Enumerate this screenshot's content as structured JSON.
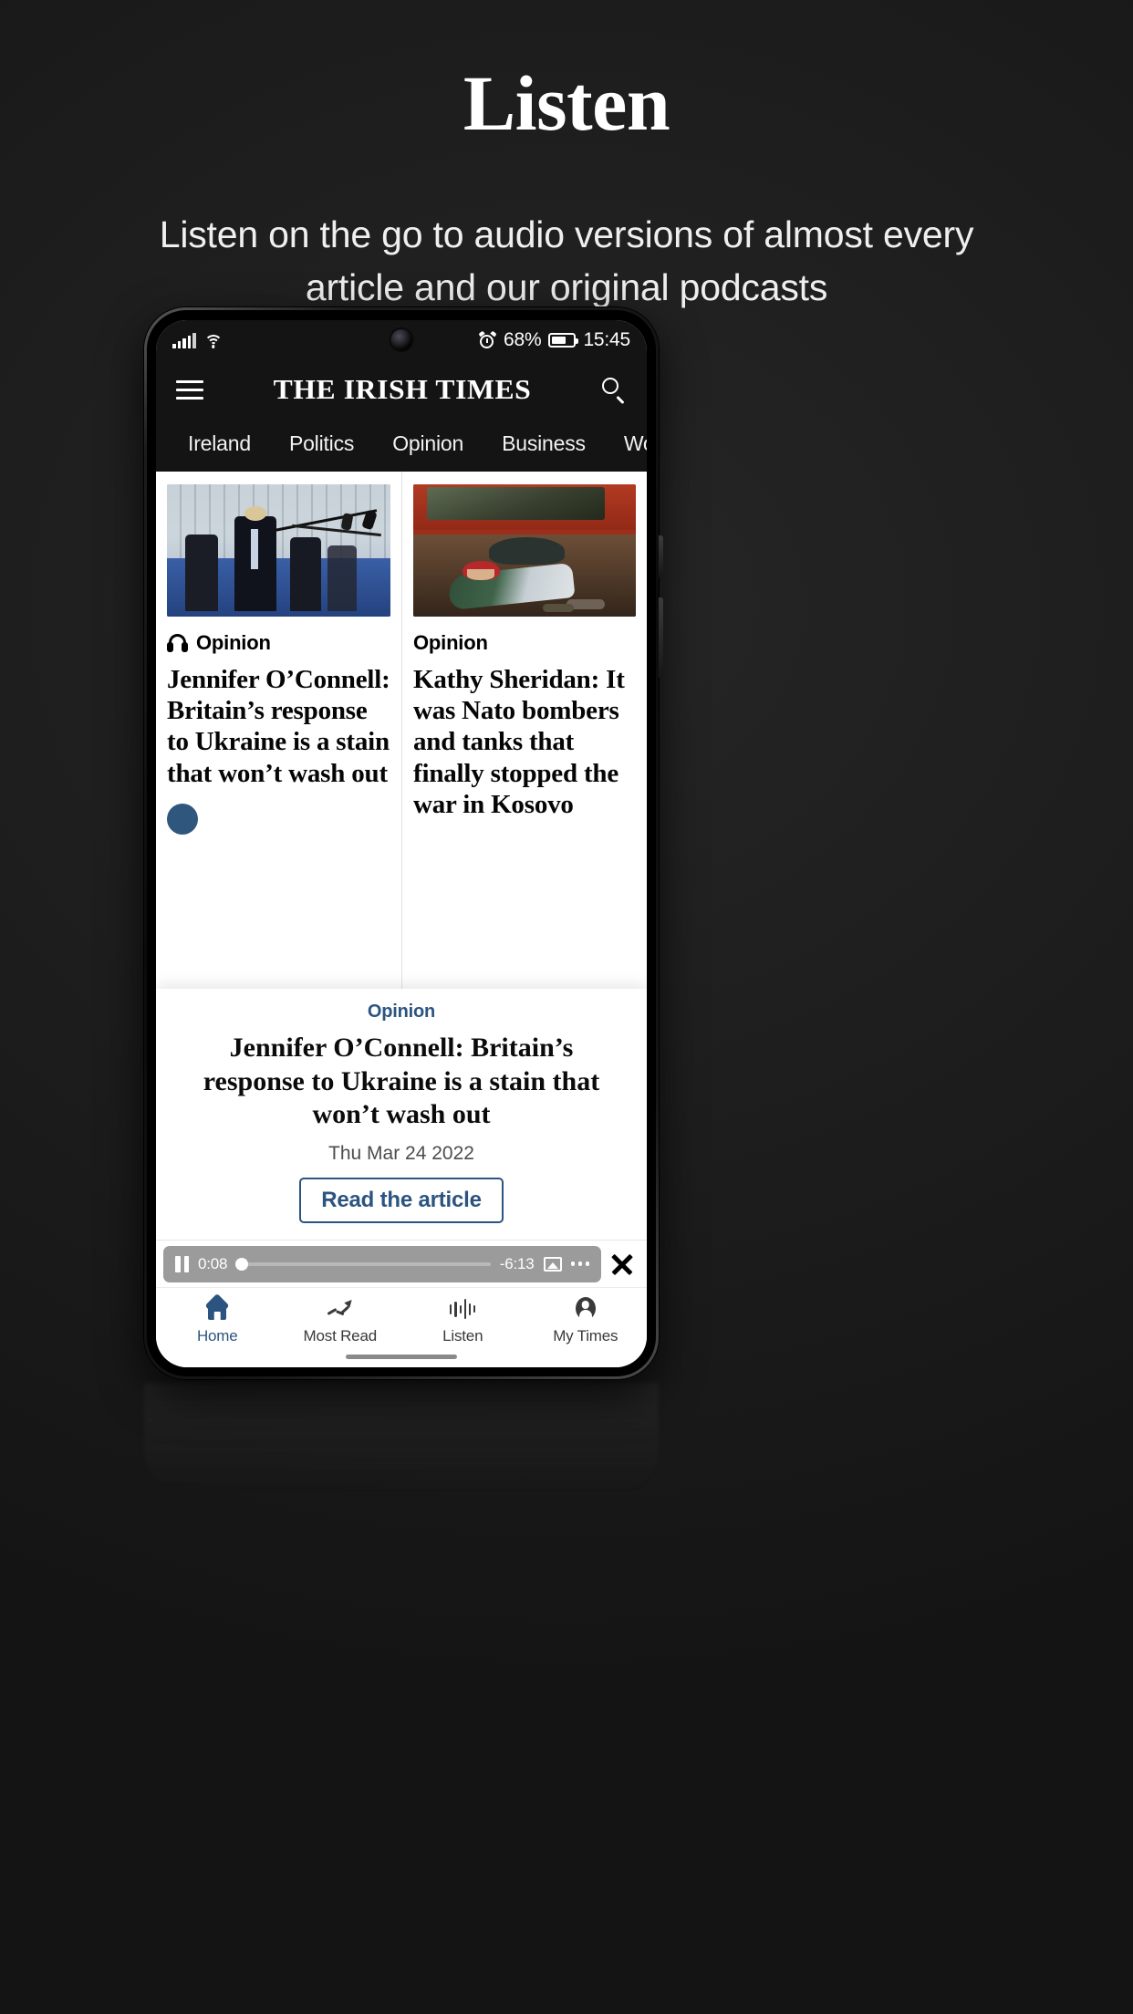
{
  "promo": {
    "title": "Listen",
    "subtitle": "Listen on the go to audio versions of almost every article and our original podcasts"
  },
  "status_bar": {
    "signal_icon": "cellular-signal-icon",
    "wifi_icon": "wifi-icon",
    "alarm_icon": "alarm-clock-icon",
    "battery_percent": "68%",
    "battery_icon": "battery-icon",
    "time": "15:45"
  },
  "app_header": {
    "menu_icon": "hamburger-menu-icon",
    "masthead": "THE IRISH TIMES",
    "search_icon": "search-icon"
  },
  "category_tabs": [
    {
      "label": "Ireland"
    },
    {
      "label": "Politics"
    },
    {
      "label": "Opinion"
    },
    {
      "label": "Business"
    },
    {
      "label": "World"
    }
  ],
  "feed": {
    "articles": [
      {
        "kicker": "Opinion",
        "has_audio": true,
        "audio_icon": "headphones-icon",
        "headline": "Jennifer O’Connell: Britain’s response to Ukraine is a stain that won’t wash out",
        "thumb_alt": "boris-johnson-press-conference-photo"
      },
      {
        "kicker": "Opinion",
        "has_audio": false,
        "headline": "Kathy Sheridan: It was Nato bombers and tanks that finally stopped the war in Kosovo",
        "thumb_alt": "kosovo-refugees-tractor-photo"
      }
    ]
  },
  "now_playing": {
    "kicker": "Opinion",
    "title": "Jennifer O’Connell: Britain’s response to Ukraine is a stain that won’t wash out",
    "date": "Thu Mar 24 2022",
    "read_button": "Read the article"
  },
  "mini_player": {
    "pause_icon": "pause-icon",
    "elapsed": "0:08",
    "remaining": "-6:13",
    "progress_percent": 2,
    "cast_icon": "cast-icon",
    "more_icon": "more-options-icon",
    "close_icon": "close-icon"
  },
  "bottom_nav": {
    "items": [
      {
        "label": "Home",
        "icon": "home-icon",
        "active": true
      },
      {
        "label": "Most Read",
        "icon": "trending-up-icon",
        "active": false
      },
      {
        "label": "Listen",
        "icon": "audio-waveform-icon",
        "active": false
      },
      {
        "label": "My Times",
        "icon": "person-account-icon",
        "active": false
      }
    ]
  },
  "colors": {
    "accent_blue": "#2c5480",
    "background": "#1a1a1a",
    "app_bar": "#141414",
    "player_pill": "#9b9b9b"
  }
}
